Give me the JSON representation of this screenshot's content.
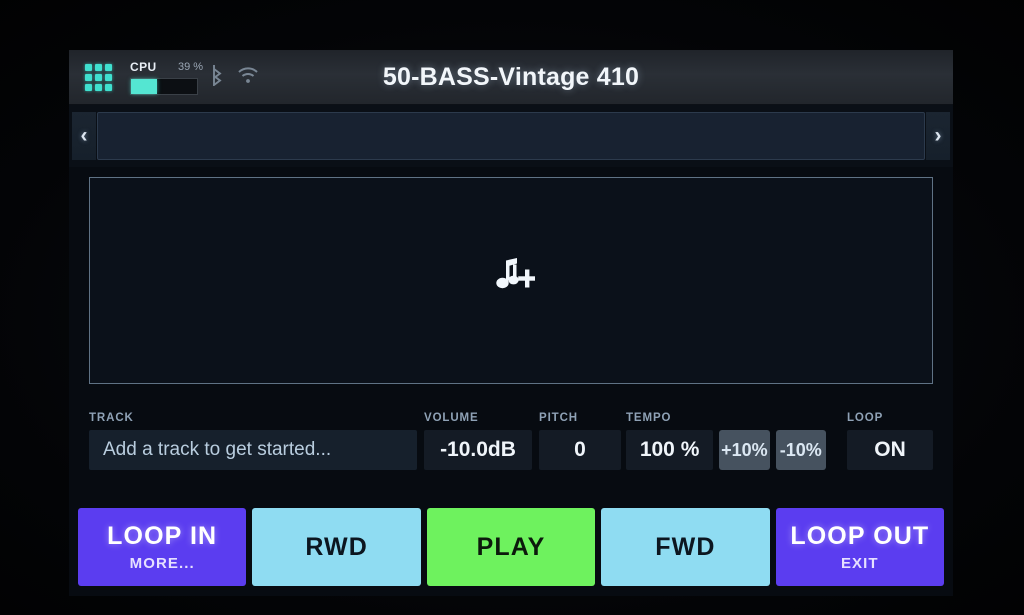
{
  "statusbar": {
    "grid_icon": "grid-apps-icon",
    "cpu_label": "CPU",
    "cpu_percent": "39 %",
    "cpu_fill_percent": 39,
    "bluetooth_icon": "bluetooth-icon",
    "wifi_icon": "wifi-icon",
    "accent_color": "#54e6d2"
  },
  "header": {
    "title": "50-BASS-Vintage 410"
  },
  "nav": {
    "prev_label": "‹",
    "next_label": "›",
    "field_value": "",
    "prev_icon": "chevron-left-icon",
    "next_icon": "chevron-right-icon"
  },
  "track_display": {
    "empty_icon": "music-note-plus-icon"
  },
  "params": {
    "track": {
      "label": "TRACK",
      "value": "Add a track to get started..."
    },
    "volume": {
      "label": "VOLUME",
      "value": "-10.0dB"
    },
    "pitch": {
      "label": "PITCH",
      "value": "0"
    },
    "tempo": {
      "label": "TEMPO",
      "value": "100 %",
      "increase_label": "+10%",
      "decrease_label": "-10%"
    },
    "loop": {
      "label": "LOOP",
      "value": "ON"
    }
  },
  "transport": {
    "buttons": [
      {
        "main": "LOOP IN",
        "sub": "MORE...",
        "color": "#5b3df0",
        "style": "purple"
      },
      {
        "main": "RWD",
        "sub": "",
        "color": "#8fdcf2",
        "style": "cyan"
      },
      {
        "main": "PLAY",
        "sub": "",
        "color": "#6ef25e",
        "style": "green"
      },
      {
        "main": "FWD",
        "sub": "",
        "color": "#8fdcf2",
        "style": "cyan"
      },
      {
        "main": "LOOP OUT",
        "sub": "EXIT",
        "color": "#5b3df0",
        "style": "purple"
      }
    ]
  }
}
